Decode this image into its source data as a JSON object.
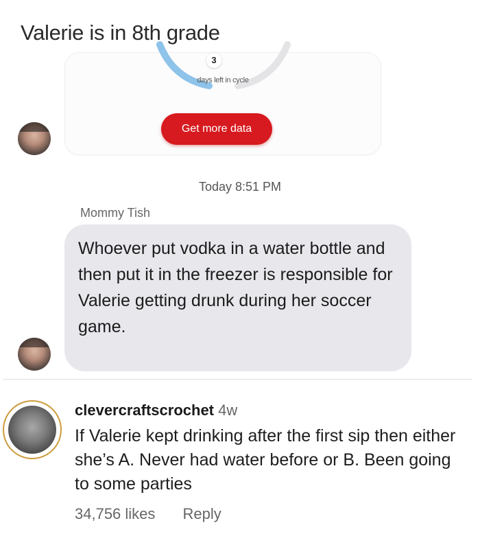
{
  "header": {
    "title": "Valerie is in 8th grade"
  },
  "data_card": {
    "days_count": "3",
    "days_caption": "days left in cycle",
    "button_label": "Get more data",
    "accent_color": "#d71a1f"
  },
  "conversation": {
    "timestamp": "Today 8:51 PM",
    "sender": "Mommy Tish",
    "message": "Whoever put vodka in a water bottle and then put it in the freezer is responsible for Valerie getting drunk during her soccer game."
  },
  "comment": {
    "username": "clevercraftscrochet",
    "age": "4w",
    "text": "If Valerie kept drinking after the first sip then either she’s A. Never had water before or B. Been going to some parties",
    "likes": "34,756 likes",
    "reply_label": "Reply"
  }
}
